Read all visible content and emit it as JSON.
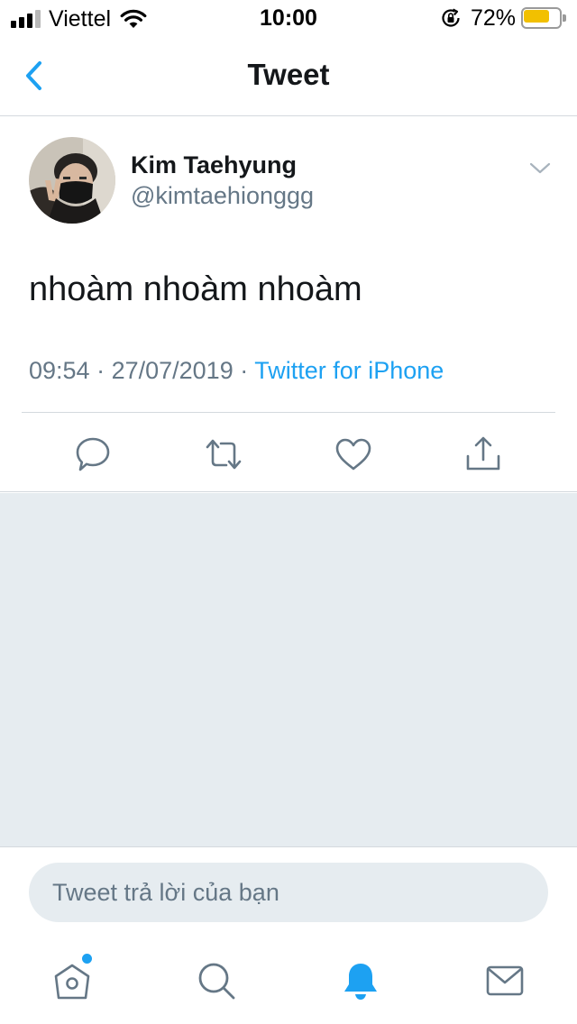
{
  "status_bar": {
    "carrier": "Viettel",
    "time": "10:00",
    "battery_percent": "72%",
    "battery_level": 0.72,
    "signal_bars_filled": 3,
    "signal_bars_total": 4
  },
  "nav": {
    "title": "Tweet",
    "back_icon": "chevron-left-icon"
  },
  "tweet": {
    "display_name": "Kim Taehyung",
    "handle": "@kimtaehionggg",
    "text": "nhoàm nhoàm nhoàm",
    "time": "09:54",
    "separator": " · ",
    "date": "27/07/2019",
    "source": "Twitter for iPhone",
    "actions": [
      "reply-icon",
      "retweet-icon",
      "like-icon",
      "share-icon"
    ]
  },
  "reply": {
    "placeholder": "Tweet trả lời của bạn"
  },
  "tab_bar": {
    "tabs": [
      "home-icon",
      "search-icon",
      "notifications-icon",
      "messages-icon"
    ],
    "active": "notifications-icon"
  },
  "colors": {
    "accent": "#1da1f2",
    "text_primary": "#14171a",
    "text_secondary": "#657786",
    "background_gray": "#e6ecf0",
    "icon_gray": "#657786",
    "battery_yellow": "#f2c000"
  }
}
